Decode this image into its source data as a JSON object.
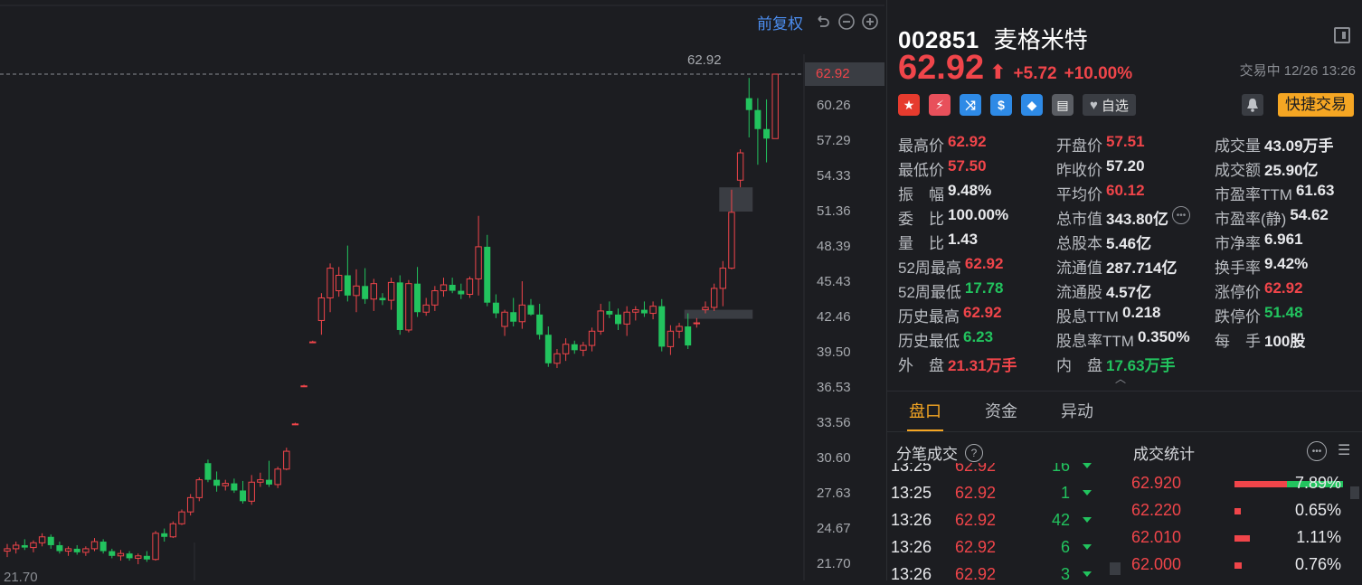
{
  "toolbar": {
    "adjust_label": "前复权"
  },
  "chart_data": {
    "type": "candlestick",
    "y_ticks": [
      "62.92",
      "60.26",
      "57.29",
      "54.33",
      "51.36",
      "48.39",
      "45.43",
      "42.46",
      "39.50",
      "36.53",
      "33.56",
      "30.60",
      "27.63",
      "24.67",
      "21.70"
    ],
    "ylim": [
      21.7,
      62.92
    ],
    "max_label": "62.92",
    "min_label": "21.70",
    "current_price_tag": "62.92",
    "candles": [
      [
        22.8,
        23.4,
        22.3,
        23.0
      ],
      [
        23.0,
        23.6,
        22.6,
        23.3
      ],
      [
        23.3,
        23.8,
        22.9,
        23.1
      ],
      [
        23.1,
        23.7,
        22.7,
        23.5
      ],
      [
        23.5,
        24.3,
        23.2,
        24.0
      ],
      [
        24.0,
        24.2,
        23.0,
        23.3
      ],
      [
        23.3,
        23.6,
        22.6,
        22.8
      ],
      [
        22.8,
        23.2,
        22.4,
        23.0
      ],
      [
        23.0,
        23.3,
        22.5,
        22.7
      ],
      [
        22.7,
        23.2,
        22.4,
        23.0
      ],
      [
        23.0,
        23.9,
        22.8,
        23.6
      ],
      [
        23.6,
        23.8,
        22.6,
        22.8
      ],
      [
        22.8,
        23.0,
        22.2,
        22.4
      ],
      [
        22.4,
        22.9,
        22.0,
        22.6
      ],
      [
        22.6,
        22.8,
        22.0,
        22.2
      ],
      [
        22.2,
        22.6,
        21.7,
        22.4
      ],
      [
        22.4,
        22.8,
        21.9,
        22.1
      ],
      [
        22.1,
        24.5,
        22.0,
        24.3
      ],
      [
        24.3,
        24.7,
        23.6,
        24.0
      ],
      [
        24.0,
        25.3,
        23.9,
        25.1
      ],
      [
        25.1,
        26.3,
        25.0,
        26.1
      ],
      [
        26.1,
        27.6,
        25.8,
        27.3
      ],
      [
        27.3,
        29.0,
        27.0,
        28.8
      ],
      [
        30.2,
        30.5,
        28.6,
        28.8
      ],
      [
        28.8,
        29.5,
        27.8,
        28.3
      ],
      [
        28.3,
        28.8,
        27.9,
        28.5
      ],
      [
        28.5,
        28.9,
        27.7,
        27.9
      ],
      [
        27.9,
        28.7,
        26.8,
        27.0
      ],
      [
        27.0,
        29.2,
        26.7,
        28.6
      ],
      [
        28.6,
        29.4,
        28.2,
        28.8
      ],
      [
        28.8,
        30.4,
        28.2,
        28.4
      ],
      [
        28.4,
        29.9,
        28.1,
        29.7
      ],
      [
        29.7,
        31.5,
        29.6,
        31.2
      ],
      [
        33.5,
        33.6,
        33.4,
        33.5
      ],
      [
        36.7,
        36.8,
        36.6,
        36.7
      ],
      [
        40.4,
        40.5,
        40.3,
        40.4
      ],
      [
        42.2,
        44.5,
        41.0,
        44.1
      ],
      [
        44.1,
        47.0,
        42.9,
        46.6
      ],
      [
        44.7,
        46.7,
        44.2,
        46.0
      ],
      [
        46.0,
        48.5,
        43.8,
        44.3
      ],
      [
        44.3,
        46.5,
        42.9,
        45.1
      ],
      [
        45.1,
        46.6,
        43.6,
        44.0
      ],
      [
        44.0,
        45.7,
        43.0,
        45.3
      ],
      [
        44.1,
        44.5,
        43.5,
        43.9
      ],
      [
        43.9,
        45.8,
        43.1,
        45.4
      ],
      [
        45.4,
        46.0,
        41.0,
        41.4
      ],
      [
        41.4,
        45.6,
        41.2,
        45.3
      ],
      [
        45.3,
        46.7,
        42.5,
        42.9
      ],
      [
        42.9,
        44.1,
        42.6,
        43.5
      ],
      [
        43.5,
        45.1,
        43.0,
        44.7
      ],
      [
        44.7,
        45.8,
        44.2,
        45.2
      ],
      [
        45.2,
        45.8,
        44.5,
        44.7
      ],
      [
        44.7,
        45.3,
        44.0,
        44.4
      ],
      [
        44.4,
        45.9,
        44.1,
        45.7
      ],
      [
        45.7,
        51.0,
        44.3,
        48.4
      ],
      [
        48.4,
        49.4,
        43.4,
        43.7
      ],
      [
        43.7,
        44.4,
        42.4,
        42.8
      ],
      [
        41.7,
        43.1,
        40.9,
        42.9
      ],
      [
        42.9,
        44.1,
        41.7,
        42.1
      ],
      [
        42.1,
        45.5,
        41.5,
        43.5
      ],
      [
        43.5,
        44.0,
        42.6,
        42.7
      ],
      [
        42.7,
        43.6,
        40.6,
        41.0
      ],
      [
        41.0,
        41.7,
        38.3,
        38.6
      ],
      [
        38.6,
        39.8,
        38.2,
        39.4
      ],
      [
        39.4,
        40.7,
        38.8,
        40.2
      ],
      [
        40.2,
        40.5,
        39.4,
        39.7
      ],
      [
        39.7,
        40.4,
        39.2,
        40.1
      ],
      [
        40.1,
        41.6,
        39.6,
        41.3
      ],
      [
        41.3,
        43.6,
        41.0,
        43.0
      ],
      [
        43.0,
        43.8,
        42.4,
        42.7
      ],
      [
        42.7,
        43.2,
        41.4,
        41.9
      ],
      [
        41.9,
        43.4,
        40.9,
        42.9
      ],
      [
        42.9,
        43.4,
        42.2,
        43.1
      ],
      [
        43.1,
        43.8,
        42.5,
        42.8
      ],
      [
        42.8,
        43.8,
        42.3,
        43.4
      ],
      [
        43.4,
        44.0,
        39.6,
        40.0
      ],
      [
        40.0,
        41.8,
        39.3,
        41.3
      ],
      [
        41.3,
        42.0,
        40.7,
        41.7
      ],
      [
        41.7,
        42.8,
        39.8,
        40.1
      ],
      [
        42.0,
        42.4,
        41.6,
        42.0
      ],
      [
        43.1,
        43.8,
        42.8,
        43.3
      ],
      [
        43.3,
        45.3,
        43.0,
        44.9
      ],
      [
        44.9,
        47.2,
        43.4,
        46.6
      ],
      [
        46.6,
        53.2,
        46.5,
        51.3
      ],
      [
        54.0,
        56.6,
        53.4,
        56.3
      ],
      [
        60.9,
        62.6,
        57.6,
        59.9
      ],
      [
        59.9,
        60.9,
        55.3,
        58.3
      ],
      [
        58.3,
        60.8,
        55.5,
        57.5
      ],
      [
        57.5,
        62.92,
        57.5,
        62.92
      ]
    ],
    "gap_zones": [
      {
        "low": 51.36,
        "high": 53.4,
        "from_index": 82,
        "to_index": 85
      },
      {
        "low": 42.4,
        "high": 43.1,
        "from_index": 78,
        "to_index": 85
      }
    ]
  },
  "quote": {
    "code": "002851",
    "name": "麦格米特",
    "price": "62.92",
    "arrow": "⬆",
    "change": "+5.72",
    "change_pct": "+10.00%",
    "status": "交易中 12/26 13:26",
    "badges": [
      {
        "name": "cn-flag-icon",
        "glyph": "★",
        "color": "#e63b2e"
      },
      {
        "name": "flash-icon",
        "glyph": "⚡",
        "color": "#e8505b"
      },
      {
        "name": "shuffle-icon",
        "glyph": "⤨",
        "color": "#2e8ae6"
      },
      {
        "name": "dollar-icon",
        "glyph": "$",
        "color": "#2e8ae6"
      },
      {
        "name": "tag-icon",
        "glyph": "◆",
        "color": "#2e8ae6"
      },
      {
        "name": "doc-icon",
        "glyph": "▤",
        "color": "#5a5d63"
      }
    ],
    "fav_label": "自选",
    "quick_trade_label": "快捷交易"
  },
  "stats": [
    [
      {
        "label": "最高价",
        "value": "62.92",
        "color": "red"
      },
      {
        "label": "开盘价",
        "value": "57.51",
        "color": "red"
      },
      {
        "label": "成交量",
        "value": "43.09万手",
        "color": "white"
      }
    ],
    [
      {
        "label": "最低价",
        "value": "57.50",
        "color": "red"
      },
      {
        "label": "昨收价",
        "value": "57.20",
        "color": "white"
      },
      {
        "label": "成交额",
        "value": "25.90亿",
        "color": "white"
      }
    ],
    [
      {
        "label": "振　幅",
        "value": "9.48%",
        "color": "white"
      },
      {
        "label": "平均价",
        "value": "60.12",
        "color": "red"
      },
      {
        "label": "市盈率TTM",
        "value": "61.63",
        "color": "white"
      }
    ],
    [
      {
        "label": "委　比",
        "value": "100.00%",
        "color": "white"
      },
      {
        "label": "总市值",
        "value": "343.80亿",
        "color": "white",
        "more": true
      },
      {
        "label": "市盈率(静)",
        "value": "54.62",
        "color": "white"
      }
    ],
    [
      {
        "label": "量　比",
        "value": "1.43",
        "color": "white"
      },
      {
        "label": "总股本",
        "value": "5.46亿",
        "color": "white"
      },
      {
        "label": "市净率",
        "value": "6.961",
        "color": "white"
      }
    ],
    [
      {
        "label": "52周最高",
        "value": "62.92",
        "color": "red"
      },
      {
        "label": "流通值",
        "value": "287.714亿",
        "color": "white"
      },
      {
        "label": "换手率",
        "value": "9.42%",
        "color": "white"
      }
    ],
    [
      {
        "label": "52周最低",
        "value": "17.78",
        "color": "green"
      },
      {
        "label": "流通股",
        "value": "4.57亿",
        "color": "white"
      },
      {
        "label": "涨停价",
        "value": "62.92",
        "color": "red"
      }
    ],
    [
      {
        "label": "历史最高",
        "value": "62.92",
        "color": "red"
      },
      {
        "label": "股息TTM",
        "value": "0.218",
        "color": "white"
      },
      {
        "label": "跌停价",
        "value": "51.48",
        "color": "green"
      }
    ],
    [
      {
        "label": "历史最低",
        "value": "6.23",
        "color": "green"
      },
      {
        "label": "股息率TTM",
        "value": "0.350%",
        "color": "white"
      },
      {
        "label": "每　手",
        "value": "100股",
        "color": "white"
      }
    ],
    [
      {
        "label": "外　盘",
        "value": "21.31万手",
        "color": "red"
      },
      {
        "label": "内　盘",
        "value": "17.63万手",
        "color": "green"
      }
    ]
  ],
  "tabs": [
    "盘口",
    "资金",
    "异动"
  ],
  "ticks_title": "分笔成交",
  "stats_title": "成交统计",
  "ticks": [
    {
      "time": "13:25",
      "price": "62.92",
      "vol": "16"
    },
    {
      "time": "13:25",
      "price": "62.92",
      "vol": "1"
    },
    {
      "time": "13:26",
      "price": "62.92",
      "vol": "42"
    },
    {
      "time": "13:26",
      "price": "62.92",
      "vol": "6"
    },
    {
      "time": "13:26",
      "price": "62.92",
      "vol": "3"
    }
  ],
  "distribution": [
    {
      "price": "62.920",
      "pct": "7.89%",
      "red": 0.48,
      "green": 0.52
    },
    {
      "price": "62.220",
      "pct": "0.65%",
      "red": 0.06,
      "green": 0
    },
    {
      "price": "62.010",
      "pct": "1.11%",
      "red": 0.14,
      "green": 0
    },
    {
      "price": "62.000",
      "pct": "0.76%",
      "red": 0.07,
      "green": 0
    }
  ]
}
